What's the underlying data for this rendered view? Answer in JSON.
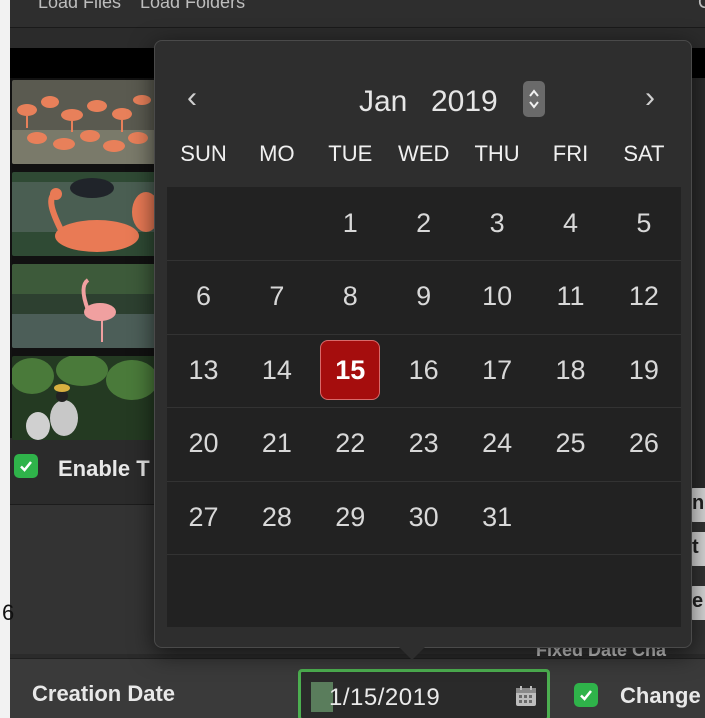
{
  "toolbar": {
    "load_files": "Load Files",
    "load_folders": "Load Folders",
    "right_cut": "C"
  },
  "thumbnails": [
    {
      "name": "flamingo-flock"
    },
    {
      "name": "flamingo-wading"
    },
    {
      "name": "flamingo-single"
    },
    {
      "name": "crowned-crane"
    }
  ],
  "enable_option": {
    "label": "Enable T",
    "checked": true
  },
  "background_text": {
    "six": "6",
    "edge1": "n",
    "edge2": "t",
    "edge3": "e",
    "fixed_date": "Fixed Date Cha"
  },
  "creation_date": {
    "label": "Creation Date",
    "value": "1/15/2019",
    "change_label": "Change",
    "change_checked": true
  },
  "calendar": {
    "month": "Jan",
    "year": "2019",
    "prev": "‹",
    "next": "›",
    "weekdays": [
      "SUN",
      "MO",
      "TUE",
      "WED",
      "THU",
      "FRI",
      "SAT"
    ],
    "days": [
      "1",
      "2",
      "3",
      "4",
      "5",
      "6",
      "7",
      "8",
      "9",
      "10",
      "11",
      "12",
      "13",
      "14",
      "15",
      "16",
      "17",
      "18",
      "19",
      "20",
      "21",
      "22",
      "23",
      "24",
      "25",
      "26",
      "27",
      "28",
      "29",
      "30",
      "31"
    ],
    "first_weekday_index": 2,
    "selected_day": "15"
  },
  "colors": {
    "accent_green": "#4caf50",
    "selected_red": "#a50d0d",
    "check_green": "#2fb34a"
  }
}
